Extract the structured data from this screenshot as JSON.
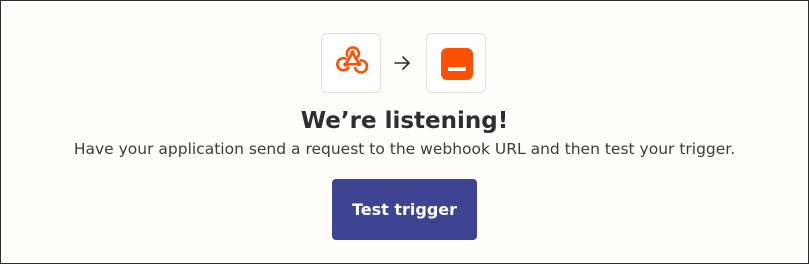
{
  "header": {
    "source_app_icon": "webhook-icon",
    "target_app_icon": "app-window-icon",
    "connector_icon": "arrow-right-icon"
  },
  "main": {
    "title": "We’re listening!",
    "description": "Have your application send a request to the webhook URL and then test your trigger.",
    "test_button_label": "Test trigger"
  },
  "colors": {
    "accent_orange": "#ff4f00",
    "button_bg": "#3d4592",
    "panel_bg": "#fffdf9",
    "text_dark": "#2d2e2e"
  }
}
